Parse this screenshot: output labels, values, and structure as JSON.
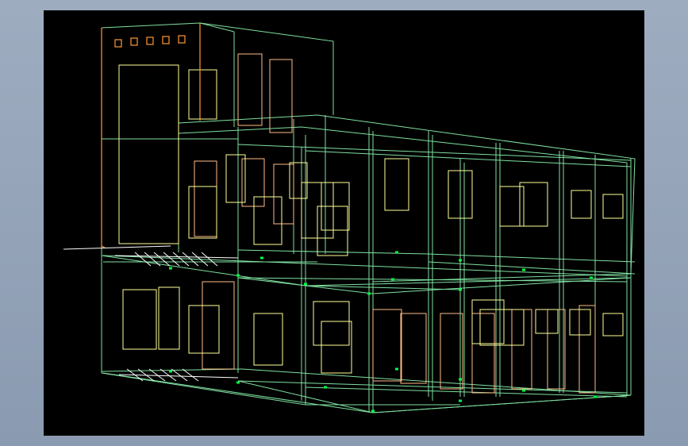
{
  "viewport": {
    "background": "#000000",
    "frame_background": "#9eacc0"
  },
  "colors": {
    "structure": "#7fe0a0",
    "node": "#00ff40",
    "window": "#ffff99",
    "door": "#ffbb88",
    "accent": "#ff9933",
    "ground_line": "#ffffff"
  }
}
